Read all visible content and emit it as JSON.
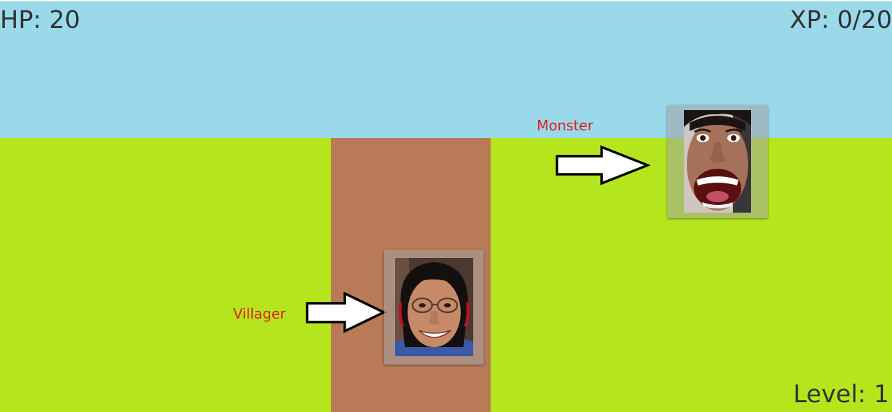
{
  "hud": {
    "hp": "HP: 20",
    "xp": "XP: 0/20",
    "level": "Level: 1"
  },
  "labels": {
    "monster": "Monster",
    "villager": "Villager"
  },
  "colors": {
    "sky": "#99d9ea",
    "grass": "#b5e61d",
    "path": "#b97a57",
    "hud_text": "#333333",
    "label_text": "#e02020",
    "arrow_stroke": "#000000",
    "arrow_fill": "#ffffff"
  },
  "icons": {
    "monster_arrow": "right-arrow-icon",
    "villager_arrow": "right-arrow-icon"
  }
}
